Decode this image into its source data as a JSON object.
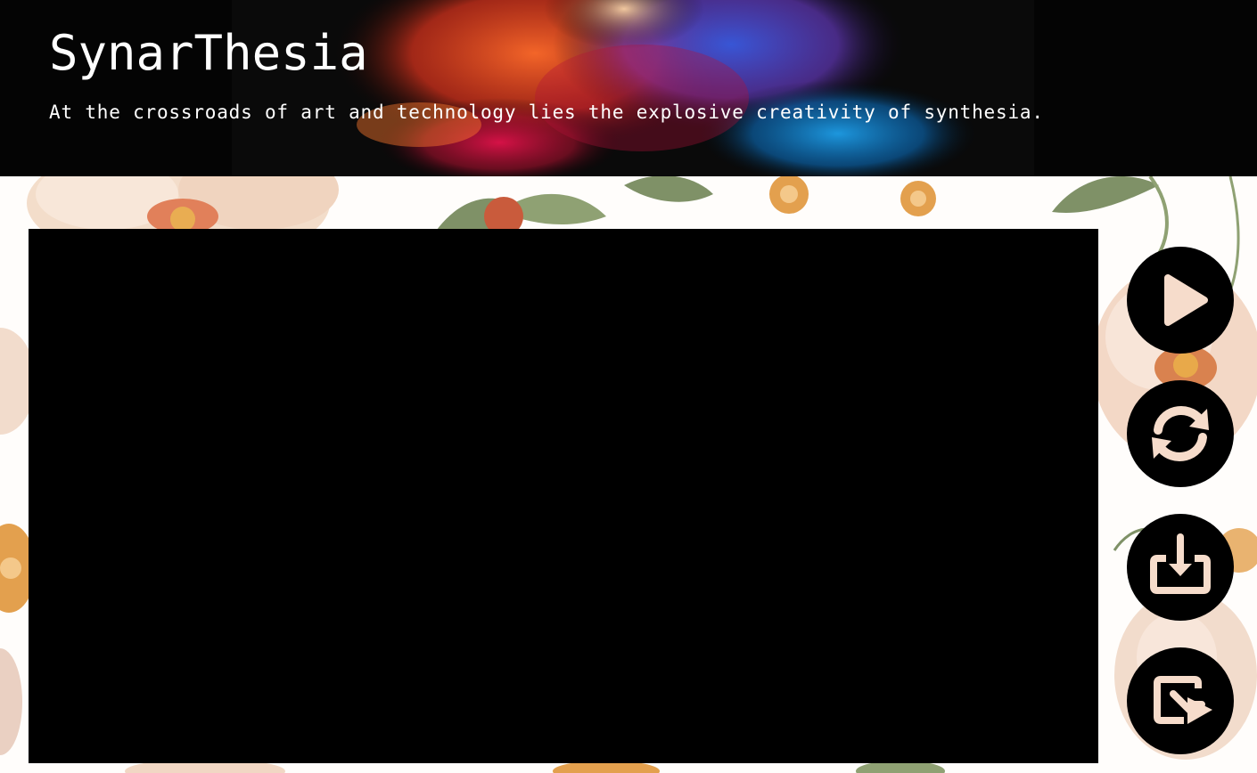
{
  "site": {
    "title": "SynarThesia",
    "tagline": "At the crossroads of art and technology lies the explosive creativity of synthesia."
  },
  "colors": {
    "header_bg": "#040404",
    "canvas_bg": "#000000",
    "button_bg": "#000000",
    "icon_fill": "#f6dccb"
  },
  "controls": [
    {
      "icon": "play-icon",
      "action": "play"
    },
    {
      "icon": "refresh-icon",
      "action": "regenerate"
    },
    {
      "icon": "download-icon",
      "action": "download"
    },
    {
      "icon": "share-icon",
      "action": "share"
    }
  ]
}
